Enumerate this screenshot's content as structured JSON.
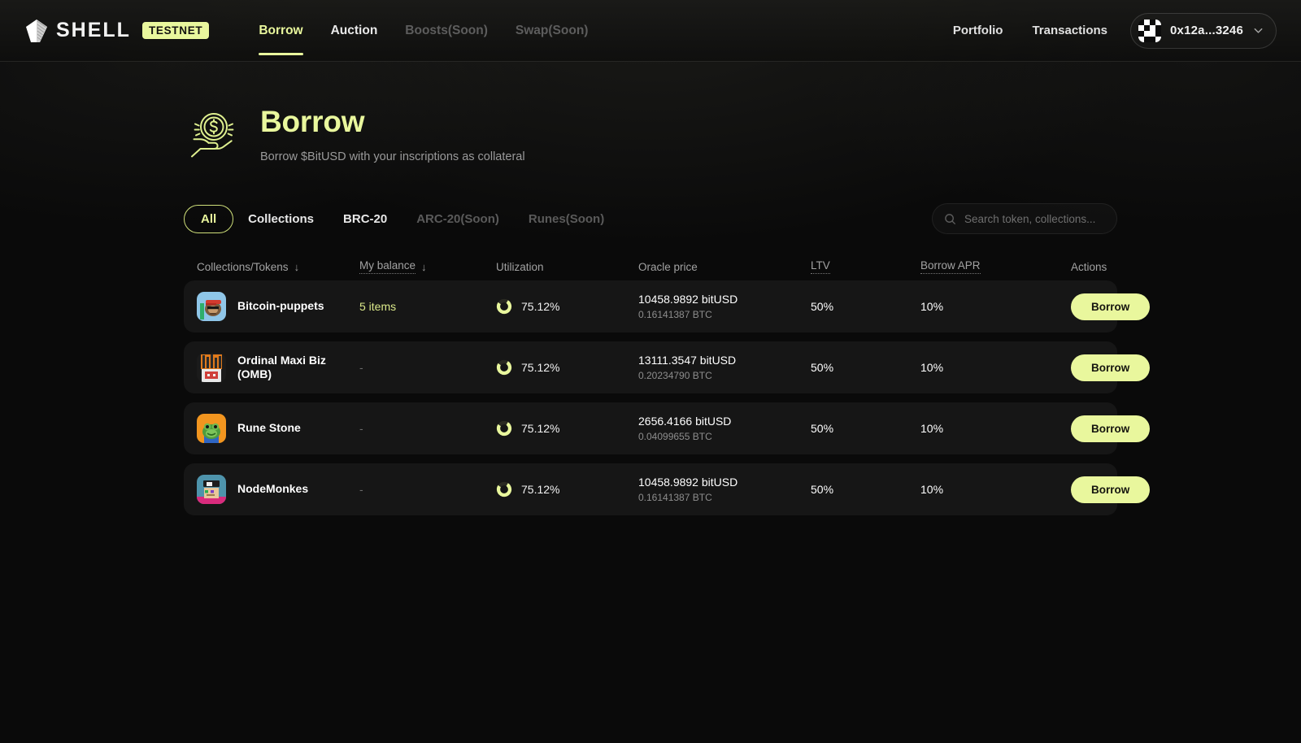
{
  "header": {
    "logo_text": "SHELL",
    "logo_icon": "shell-diamond-icon",
    "badge": "TESTNET",
    "nav": [
      {
        "label": "Borrow",
        "state": "active"
      },
      {
        "label": "Auction",
        "state": "normal"
      },
      {
        "label": "Boosts(Soon)",
        "state": "disabled"
      },
      {
        "label": "Swap(Soon)",
        "state": "disabled"
      }
    ],
    "links": [
      {
        "label": "Portfolio"
      },
      {
        "label": "Transactions"
      }
    ],
    "wallet": {
      "address": "0x12a...3246",
      "avatar_icon": "pixel-blockie-icon",
      "chevron_icon": "chevron-down-icon"
    }
  },
  "hero": {
    "icon": "hand-holding-coin-icon",
    "title": "Borrow",
    "subtitle": "Borrow $BitUSD with your inscriptions as collateral"
  },
  "filters": {
    "tabs": [
      {
        "label": "All",
        "state": "active"
      },
      {
        "label": "Collections",
        "state": "normal"
      },
      {
        "label": "BRC-20",
        "state": "normal"
      },
      {
        "label": "ARC-20(Soon)",
        "state": "disabled"
      },
      {
        "label": "Runes(Soon)",
        "state": "disabled"
      }
    ],
    "search": {
      "placeholder": "Search token, collections...",
      "value": "",
      "icon": "search-icon"
    }
  },
  "table": {
    "columns": [
      {
        "label": "Collections/Tokens",
        "sortable": true,
        "underline": false
      },
      {
        "label": "My balance",
        "sortable": true,
        "underline": true
      },
      {
        "label": "Utilization",
        "sortable": false,
        "underline": false
      },
      {
        "label": "Oracle price",
        "sortable": false,
        "underline": false
      },
      {
        "label": "LTV",
        "sortable": false,
        "underline": true
      },
      {
        "label": "Borrow APR",
        "sortable": false,
        "underline": true
      },
      {
        "label": "Actions",
        "sortable": false,
        "underline": false
      }
    ],
    "rows": [
      {
        "name": "Bitcoin-puppets",
        "balance": "5 items",
        "balance_is_value": true,
        "utilization": "75.12%",
        "utilization_pct": 75.12,
        "oracle_main": "10458.9892 bitUSD",
        "oracle_sub": "0.16141387 BTC",
        "ltv": "50%",
        "apr": "10%",
        "action": "Borrow",
        "avatar": "bitcoin-puppets-avatar"
      },
      {
        "name": "Ordinal Maxi Biz (OMB)",
        "balance": "-",
        "balance_is_value": false,
        "utilization": "75.12%",
        "utilization_pct": 75.12,
        "oracle_main": "13111.3547 bitUSD",
        "oracle_sub": "0.20234790 BTC",
        "ltv": "50%",
        "apr": "10%",
        "action": "Borrow",
        "avatar": "ordinal-maxi-biz-avatar"
      },
      {
        "name": "Rune Stone",
        "balance": "-",
        "balance_is_value": false,
        "utilization": "75.12%",
        "utilization_pct": 75.12,
        "oracle_main": "2656.4166 bitUSD",
        "oracle_sub": "0.04099655 BTC",
        "ltv": "50%",
        "apr": "10%",
        "action": "Borrow",
        "avatar": "rune-stone-avatar"
      },
      {
        "name": "NodeMonkes",
        "balance": "-",
        "balance_is_value": false,
        "utilization": "75.12%",
        "utilization_pct": 75.12,
        "oracle_main": "10458.9892 bitUSD",
        "oracle_sub": "0.16141387 BTC",
        "ltv": "50%",
        "apr": "10%",
        "action": "Borrow",
        "avatar": "nodemonkes-avatar"
      }
    ]
  },
  "colors": {
    "accent": "#e9f79d",
    "accent_border": "#cfe07a",
    "page_bg": "#0a0a0a",
    "row_bg": "#161616",
    "muted": "#8d8d8d",
    "disabled": "#5a5a5a"
  }
}
